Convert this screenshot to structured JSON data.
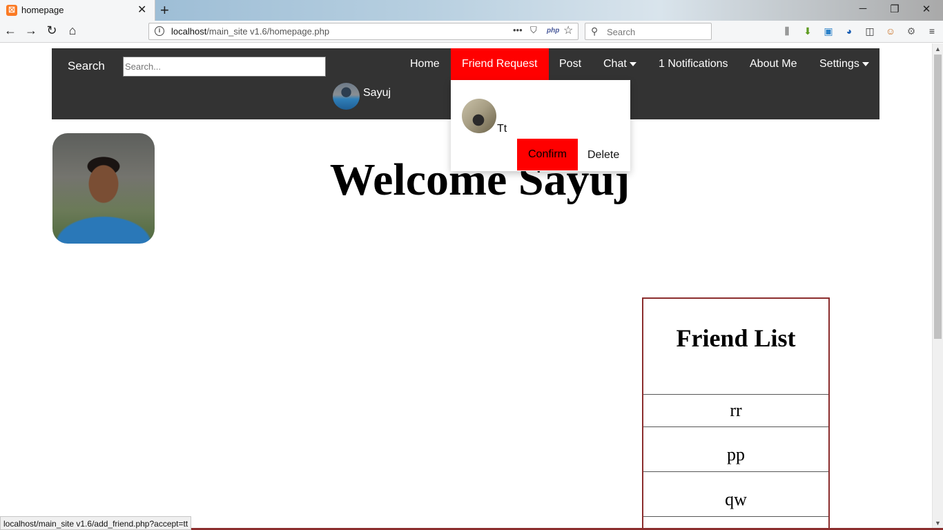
{
  "browser": {
    "tab_title": "homepage",
    "url_host": "localhost",
    "url_path": "/main_site v1.6/homepage.php",
    "search_placeholder": "Search",
    "status_text": "localhost/main_site v1.6/add_friend.php?accept=tt"
  },
  "nav": {
    "search_label": "Search",
    "search_placeholder": "Search...",
    "home": "Home",
    "friend_request": "Friend Request",
    "post": "Post",
    "chat": "Chat",
    "notifications": "1 Notifications",
    "about": "About Me",
    "settings": "Settings",
    "user_name": "Sayuj"
  },
  "dropdown": {
    "requester_name": "Tt",
    "confirm_label": "Confirm",
    "delete_label": "Delete"
  },
  "welcome": "Welcome Sayuj",
  "friend_list": {
    "title": "Friend List",
    "friends": [
      "rr",
      "pp",
      "qw"
    ]
  },
  "colors": {
    "nav_bg": "#333333",
    "accent": "#ff0000",
    "friend_list_border": "#8b2d2d"
  }
}
